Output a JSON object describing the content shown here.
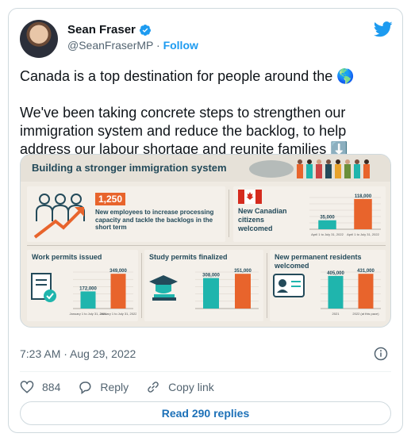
{
  "tweet": {
    "author_name": "Sean Fraser",
    "author_handle": "@SeanFraserMP",
    "separator": "·",
    "follow_label": "Follow",
    "text_line1": "Canada is a top destination for people around the 🌎",
    "text_line2": "We've been taking concrete steps to strengthen our immigration system and reduce the backlog, to help address our labour shortage and reunite families ⬇️",
    "timestamp": "7:23 AM · Aug 29, 2022",
    "likes_count": "884",
    "reply_label": "Reply",
    "copy_link_label": "Copy link",
    "read_replies_label": "Read 290 replies"
  },
  "colors": {
    "accent": "#1d9bf0",
    "orange": "#e8642c",
    "teal": "#1fb5ad",
    "navy": "#234a5a"
  },
  "infographic": {
    "title": "Building a stronger immigration system",
    "new_employees_count": "1,250",
    "new_employees_desc": "New employees to increase processing capacity and tackle the backlogs in the short term",
    "citizens_title": "New Canadian citizens welcomed",
    "work_permits_title": "Work permits issued",
    "study_permits_title": "Study permits finalized",
    "pr_title": "New permanent residents welcomed"
  },
  "chart_data": [
    {
      "type": "bar",
      "title": "New Canadian citizens welcomed",
      "categories": [
        "April 1 to July 31, 2022",
        "April 1 to July 31, 2022"
      ],
      "values": [
        35000,
        118000
      ],
      "labels": [
        "35,000",
        "118,000"
      ]
    },
    {
      "type": "bar",
      "title": "Work permits issued",
      "categories": [
        "January 1 to July 31, 2021",
        "January 1 to July 31, 2022"
      ],
      "values": [
        172000,
        349000
      ],
      "labels": [
        "172,000",
        "349,000"
      ]
    },
    {
      "type": "bar",
      "title": "Study permits finalized",
      "categories": [
        "",
        ""
      ],
      "values": [
        308000,
        351000
      ],
      "labels": [
        "308,000",
        "351,000"
      ]
    },
    {
      "type": "bar",
      "title": "New permanent residents welcomed",
      "categories": [
        "2021",
        "2022 (at this pace)"
      ],
      "values": [
        405000,
        431000
      ],
      "labels": [
        "405,000",
        "431,000"
      ]
    }
  ]
}
